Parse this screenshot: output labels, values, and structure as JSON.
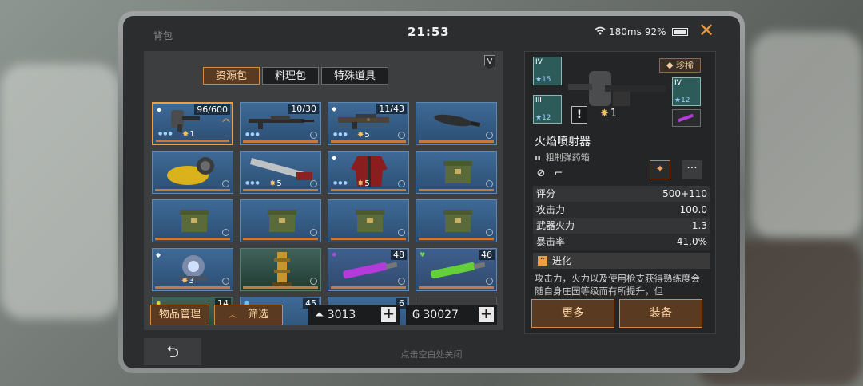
{
  "status": {
    "title": "背包",
    "clock": "21:53",
    "ping": "180ms",
    "battery": "92%"
  },
  "tabs": [
    {
      "label": "资源包",
      "active": true
    },
    {
      "label": "料理包",
      "active": false
    },
    {
      "label": "特殊道具",
      "active": false
    }
  ],
  "tier_badge": "V",
  "slots": [
    {
      "count": "96/600",
      "level": "1"
    },
    {
      "count": "10/30",
      "level": ""
    },
    {
      "count": "11/43",
      "level": "5"
    },
    {
      "count": "",
      "level": ""
    },
    {
      "count": "",
      "level": ""
    },
    {
      "count": "",
      "level": "5"
    },
    {
      "count": "",
      "level": "5"
    },
    {
      "count": "",
      "level": ""
    },
    {
      "count": "",
      "level": ""
    },
    {
      "count": "",
      "level": ""
    },
    {
      "count": "",
      "level": ""
    },
    {
      "count": "",
      "level": ""
    },
    {
      "count": "",
      "level": "3"
    },
    {
      "count": "",
      "level": ""
    },
    {
      "count": "48",
      "level": ""
    },
    {
      "count": "46",
      "level": ""
    },
    {
      "count": "14",
      "level": ""
    },
    {
      "count": "45",
      "level": ""
    },
    {
      "count": "6",
      "level": ""
    },
    {
      "count": "",
      "level": ""
    }
  ],
  "bottom": {
    "manage_label": "物品管理",
    "filter_label": "筛选",
    "currency1": "3013",
    "currency2": "30027",
    "hint": "点击空白处关闭"
  },
  "detail": {
    "rarity": "珍稀",
    "mods": [
      {
        "roman": "IV",
        "level": "15"
      },
      {
        "roman": "III",
        "level": "12"
      },
      {
        "roman": "IV",
        "level": "12"
      }
    ],
    "exclamation": "!",
    "level": "1",
    "name": "火焰喷射器",
    "ammo": "粗制弹药箱",
    "stats": [
      {
        "key": "评分",
        "value": "500+110"
      },
      {
        "key": "攻击力",
        "value": "100.0"
      },
      {
        "key": "武器火力",
        "value": "1.3"
      },
      {
        "key": "暴击率",
        "value": "41.0%"
      }
    ],
    "evo_label": "进化",
    "description": "攻击力，火力以及使用枪支获得熟练度会随自身庄园等级而有所提升，但",
    "more_label": "更多",
    "equip_label": "装备"
  },
  "colors": {
    "accent": "#d58a42",
    "slot_blue": "#3e6a96",
    "panel": "#3c3e3f"
  }
}
